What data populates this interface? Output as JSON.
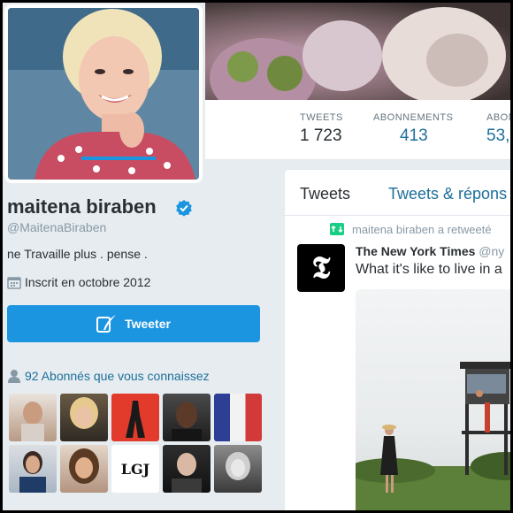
{
  "nav": {
    "tweets": {
      "label": "TWEETS",
      "value": "1 723"
    },
    "following": {
      "label": "ABONNEMENTS",
      "value": "413"
    },
    "followers": {
      "label": "ABON",
      "value": "53,"
    }
  },
  "profile": {
    "name": "maitena biraben",
    "handle": "@MaitenaBiraben",
    "bio": "ne Travaille plus . pense .",
    "joined": "Inscrit en octobre 2012",
    "tweet_button": "Tweeter",
    "followers_you_know": "92 Abonnés que vous connaissez"
  },
  "timeline": {
    "tab_tweets": "Tweets",
    "tab_replies": "Tweets & répons",
    "retweet_line": "maitena biraben a retweeté",
    "author_name": "The New York Times",
    "author_handle": "@ny",
    "tweet_text": "What it's like to live in a"
  },
  "thumbnails": [
    {
      "caption": ""
    },
    {
      "caption": ""
    },
    {
      "caption": ""
    },
    {
      "caption": ""
    },
    {
      "caption": ""
    },
    {
      "caption": ""
    },
    {
      "caption": ""
    },
    {
      "caption": "LGJ"
    },
    {
      "caption": ""
    },
    {
      "caption": ""
    }
  ],
  "colors": {
    "accent": "#1b95e0",
    "link": "#1d6f9a",
    "text": "#292f33",
    "muted": "#8899a6"
  }
}
